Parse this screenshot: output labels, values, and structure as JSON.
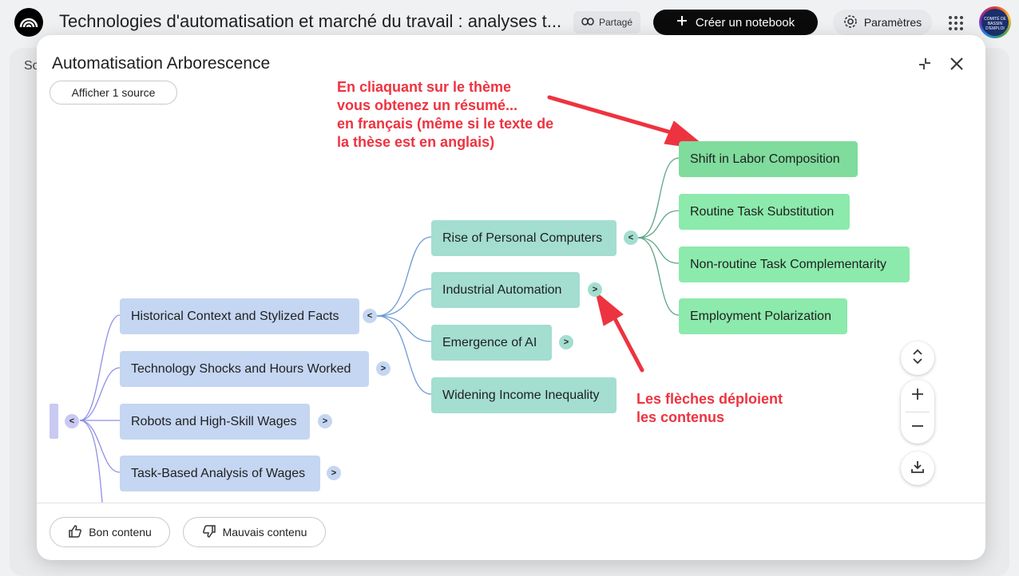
{
  "topbar": {
    "title": "Technologies d'automatisation et marché du travail : analyses t...",
    "share_label": "Partagé",
    "create_label": "Créer un notebook",
    "settings_label": "Paramètres",
    "avatar_text": "COMITÉ DE BASSIN D'EMPLOI"
  },
  "background": {
    "partial_label": "So"
  },
  "modal": {
    "title": "Automatisation Arborescence",
    "source_button": "Afficher 1 source",
    "footer": {
      "good_label": "Bon contenu",
      "bad_label": "Mauvais contenu"
    }
  },
  "mindmap": {
    "level1": [
      {
        "label": "Historical Context and Stylized Facts",
        "toggle": "<"
      },
      {
        "label": "Technology Shocks and Hours Worked",
        "toggle": ">"
      },
      {
        "label": "Robots and High-Skill Wages",
        "toggle": ">"
      },
      {
        "label": "Task-Based Analysis of Wages",
        "toggle": ">"
      }
    ],
    "level2": [
      {
        "label": "Rise of Personal Computers",
        "toggle": "<"
      },
      {
        "label": "Industrial Automation",
        "toggle": ">"
      },
      {
        "label": "Emergence of AI",
        "toggle": ">"
      },
      {
        "label": "Widening Income Inequality"
      }
    ],
    "level3": [
      {
        "label": "Shift in Labor Composition"
      },
      {
        "label": "Routine Task Substitution"
      },
      {
        "label": "Non-routine Task Complementarity"
      },
      {
        "label": "Employment Polarization"
      }
    ],
    "root_toggle": "<"
  },
  "annotations": {
    "top": [
      "En cliaquant sur le thème",
      "vous obtenez un résumé...",
      "en français (même si le texte de",
      "la thèse est en anglais)"
    ],
    "bottom": [
      "Les flèches déploient",
      "les contenus"
    ],
    "color": "#ee3340"
  },
  "icons": {
    "logo": "notebooklm-logo-icon",
    "share": "link-icon",
    "create": "plus-icon",
    "settings": "gear-icon",
    "apps": "apps-grid-icon",
    "collapse": "collapse-icon",
    "close": "close-icon",
    "fit": "expand-vertical-icon",
    "zoom_in": "plus-icon",
    "zoom_out": "minus-icon",
    "download": "download-icon",
    "thumbs_up": "thumbs-up-icon",
    "thumbs_down": "thumbs-down-icon"
  }
}
